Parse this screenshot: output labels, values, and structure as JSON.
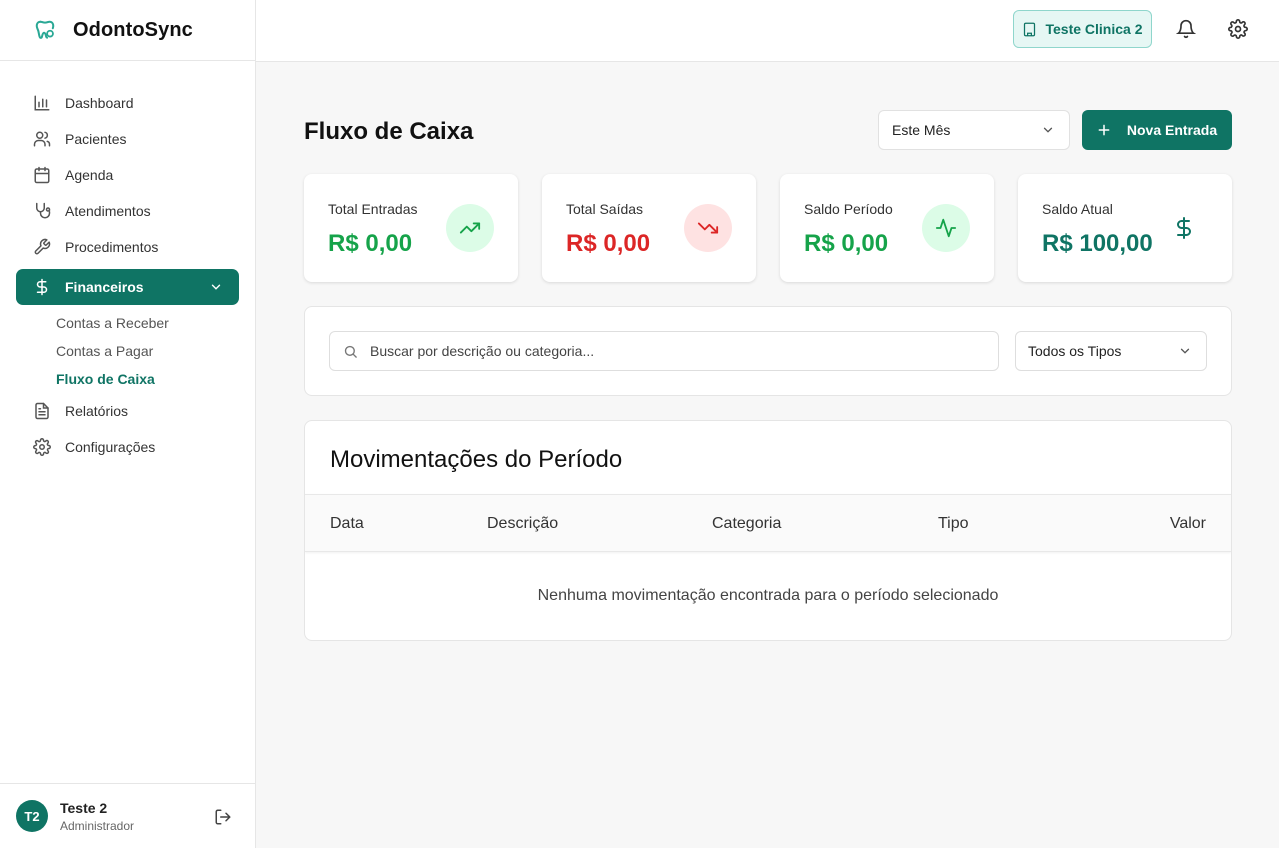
{
  "app": {
    "name": "OdontoSync"
  },
  "sidebar": {
    "items": [
      {
        "label": "Dashboard",
        "icon": "bar-chart-icon"
      },
      {
        "label": "Pacientes",
        "icon": "users-icon"
      },
      {
        "label": "Agenda",
        "icon": "calendar-icon"
      },
      {
        "label": "Atendimentos",
        "icon": "stethoscope-icon"
      },
      {
        "label": "Procedimentos",
        "icon": "wrench-icon"
      },
      {
        "label": "Financeiros",
        "icon": "dollar-icon",
        "active": true
      },
      {
        "label": "Relatórios",
        "icon": "document-icon"
      },
      {
        "label": "Configurações",
        "icon": "gear-icon"
      }
    ],
    "submenu": [
      "Contas a Receber",
      "Contas a Pagar",
      "Fluxo de Caixa"
    ],
    "submenu_current": "Fluxo de Caixa"
  },
  "user": {
    "initials": "T2",
    "name": "Teste 2",
    "role": "Administrador"
  },
  "topbar": {
    "clinic": "Teste Clinica 2"
  },
  "page": {
    "title": "Fluxo de Caixa",
    "period": "Este Mês",
    "new_button": "Nova Entrada"
  },
  "cards": [
    {
      "label": "Total Entradas",
      "value": "R$ 0,00",
      "color": "#16a34a",
      "icon": "trending-up-icon"
    },
    {
      "label": "Total Saídas",
      "value": "R$ 0,00",
      "color": "#dc2626",
      "icon": "trending-down-icon"
    },
    {
      "label": "Saldo Período",
      "value": "R$ 0,00",
      "color": "#16a34a",
      "icon": "activity-icon"
    },
    {
      "label": "Saldo Atual",
      "value": "R$ 100,00",
      "color": "#0f7464",
      "icon": "dollar-icon"
    }
  ],
  "filters": {
    "search_placeholder": "Buscar por descrição ou categoria...",
    "type": "Todos os Tipos"
  },
  "table": {
    "title": "Movimentações do Período",
    "columns": [
      "Data",
      "Descrição",
      "Categoria",
      "Tipo",
      "Valor"
    ],
    "empty": "Nenhuma movimentação encontrada para o período selecionado"
  },
  "colors": {
    "primary": "#0f7464",
    "positive": "#16a34a",
    "negative": "#dc2626"
  }
}
